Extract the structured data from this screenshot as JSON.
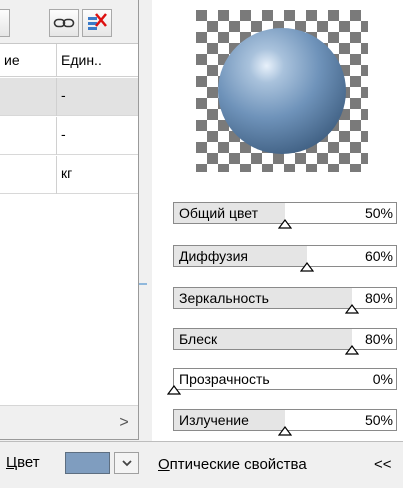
{
  "left": {
    "header": {
      "col1_label": "ие",
      "col2_label": "Един.."
    },
    "rows": [
      {
        "unit": "-",
        "selected": true
      },
      {
        "unit": "-",
        "selected": false
      },
      {
        "unit": "кг",
        "selected": false
      }
    ],
    "color": {
      "label_first": "Ц",
      "label_rest": "вет",
      "value_hex": "#7f9dbf"
    },
    "scroll_right_glyph": ">"
  },
  "right": {
    "sliders": [
      {
        "label": "Общий цвет",
        "percent_label": "50%",
        "value": 0.5
      },
      {
        "label": "Диффузия",
        "percent_label": "60%",
        "value": 0.6
      },
      {
        "label": "Зеркальность",
        "percent_label": "80%",
        "value": 0.8
      },
      {
        "label": "Блеск",
        "percent_label": "80%",
        "value": 0.8
      },
      {
        "label": "Прозрачность",
        "percent_label": "0%",
        "value": 0.0
      },
      {
        "label": "Излучение",
        "percent_label": "50%",
        "value": 0.5
      }
    ],
    "optical": {
      "label_first": "О",
      "label_rest": "птические свойства",
      "collapse": "<<"
    }
  },
  "colors": {
    "sphere": "#6f93ba",
    "checker_dark": "#7a7a7a",
    "checker_light": "#ffffff"
  },
  "icons": [
    "link-icon",
    "delete-rows-icon",
    "chevron-down-icon",
    "chevron-right-icon",
    "slider-thumb-icon"
  ]
}
